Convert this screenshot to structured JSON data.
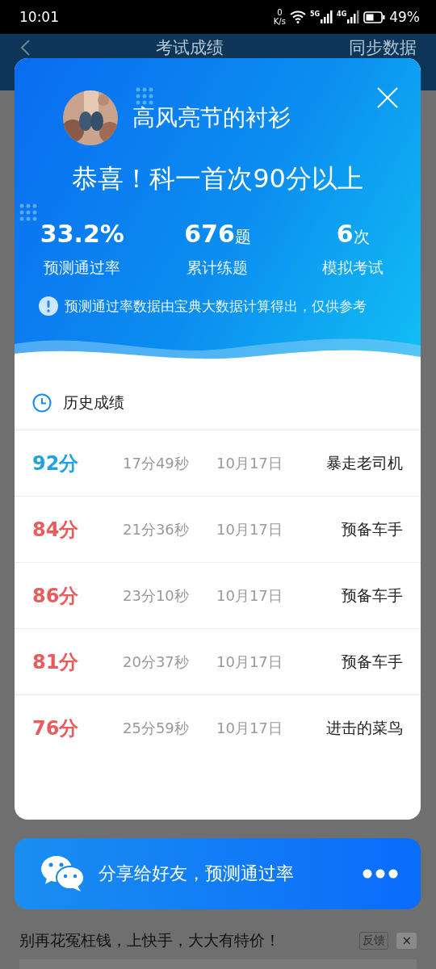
{
  "status_bar": {
    "time": "10:01",
    "net_speed_value": "0",
    "net_speed_unit": "K/s",
    "signal_1": "5G",
    "signal_2": "4G",
    "battery": "49%"
  },
  "background_page": {
    "title": "考试成绩",
    "action": "同步数据",
    "ad_text": "别再花冤枉钱，上快手，大大有特价！",
    "ad_feedback": "反馈",
    "ad_close": "×"
  },
  "dialog": {
    "user_name": "高风亮节的衬衫",
    "headline": "恭喜！科一首次90分以上",
    "stats": [
      {
        "value": "33.2%",
        "label": "预测通过率"
      },
      {
        "value": "676",
        "unit": "题",
        "label": "累计练题"
      },
      {
        "value": "6",
        "unit": "次",
        "label": "模拟考试"
      }
    ],
    "notice": "预测通过率数据由宝典大数据计算得出，仅供参考",
    "history_title": "历史成绩",
    "history": [
      {
        "score": "92分",
        "color": "#1ea3e0",
        "duration": "17分49秒",
        "date": "10月17日",
        "title": "暴走老司机"
      },
      {
        "score": "84分",
        "color": "#e85c5c",
        "duration": "21分36秒",
        "date": "10月17日",
        "title": "预备车手"
      },
      {
        "score": "86分",
        "color": "#e85c5c",
        "duration": "23分10秒",
        "date": "10月17日",
        "title": "预备车手"
      },
      {
        "score": "81分",
        "color": "#e85c5c",
        "duration": "20分37秒",
        "date": "10月17日",
        "title": "预备车手"
      },
      {
        "score": "76分",
        "color": "#e85c5c",
        "duration": "25分59秒",
        "date": "10月17日",
        "title": "进击的菜鸟"
      }
    ]
  },
  "share_bar": {
    "text": "分享给好友，预测通过率"
  }
}
